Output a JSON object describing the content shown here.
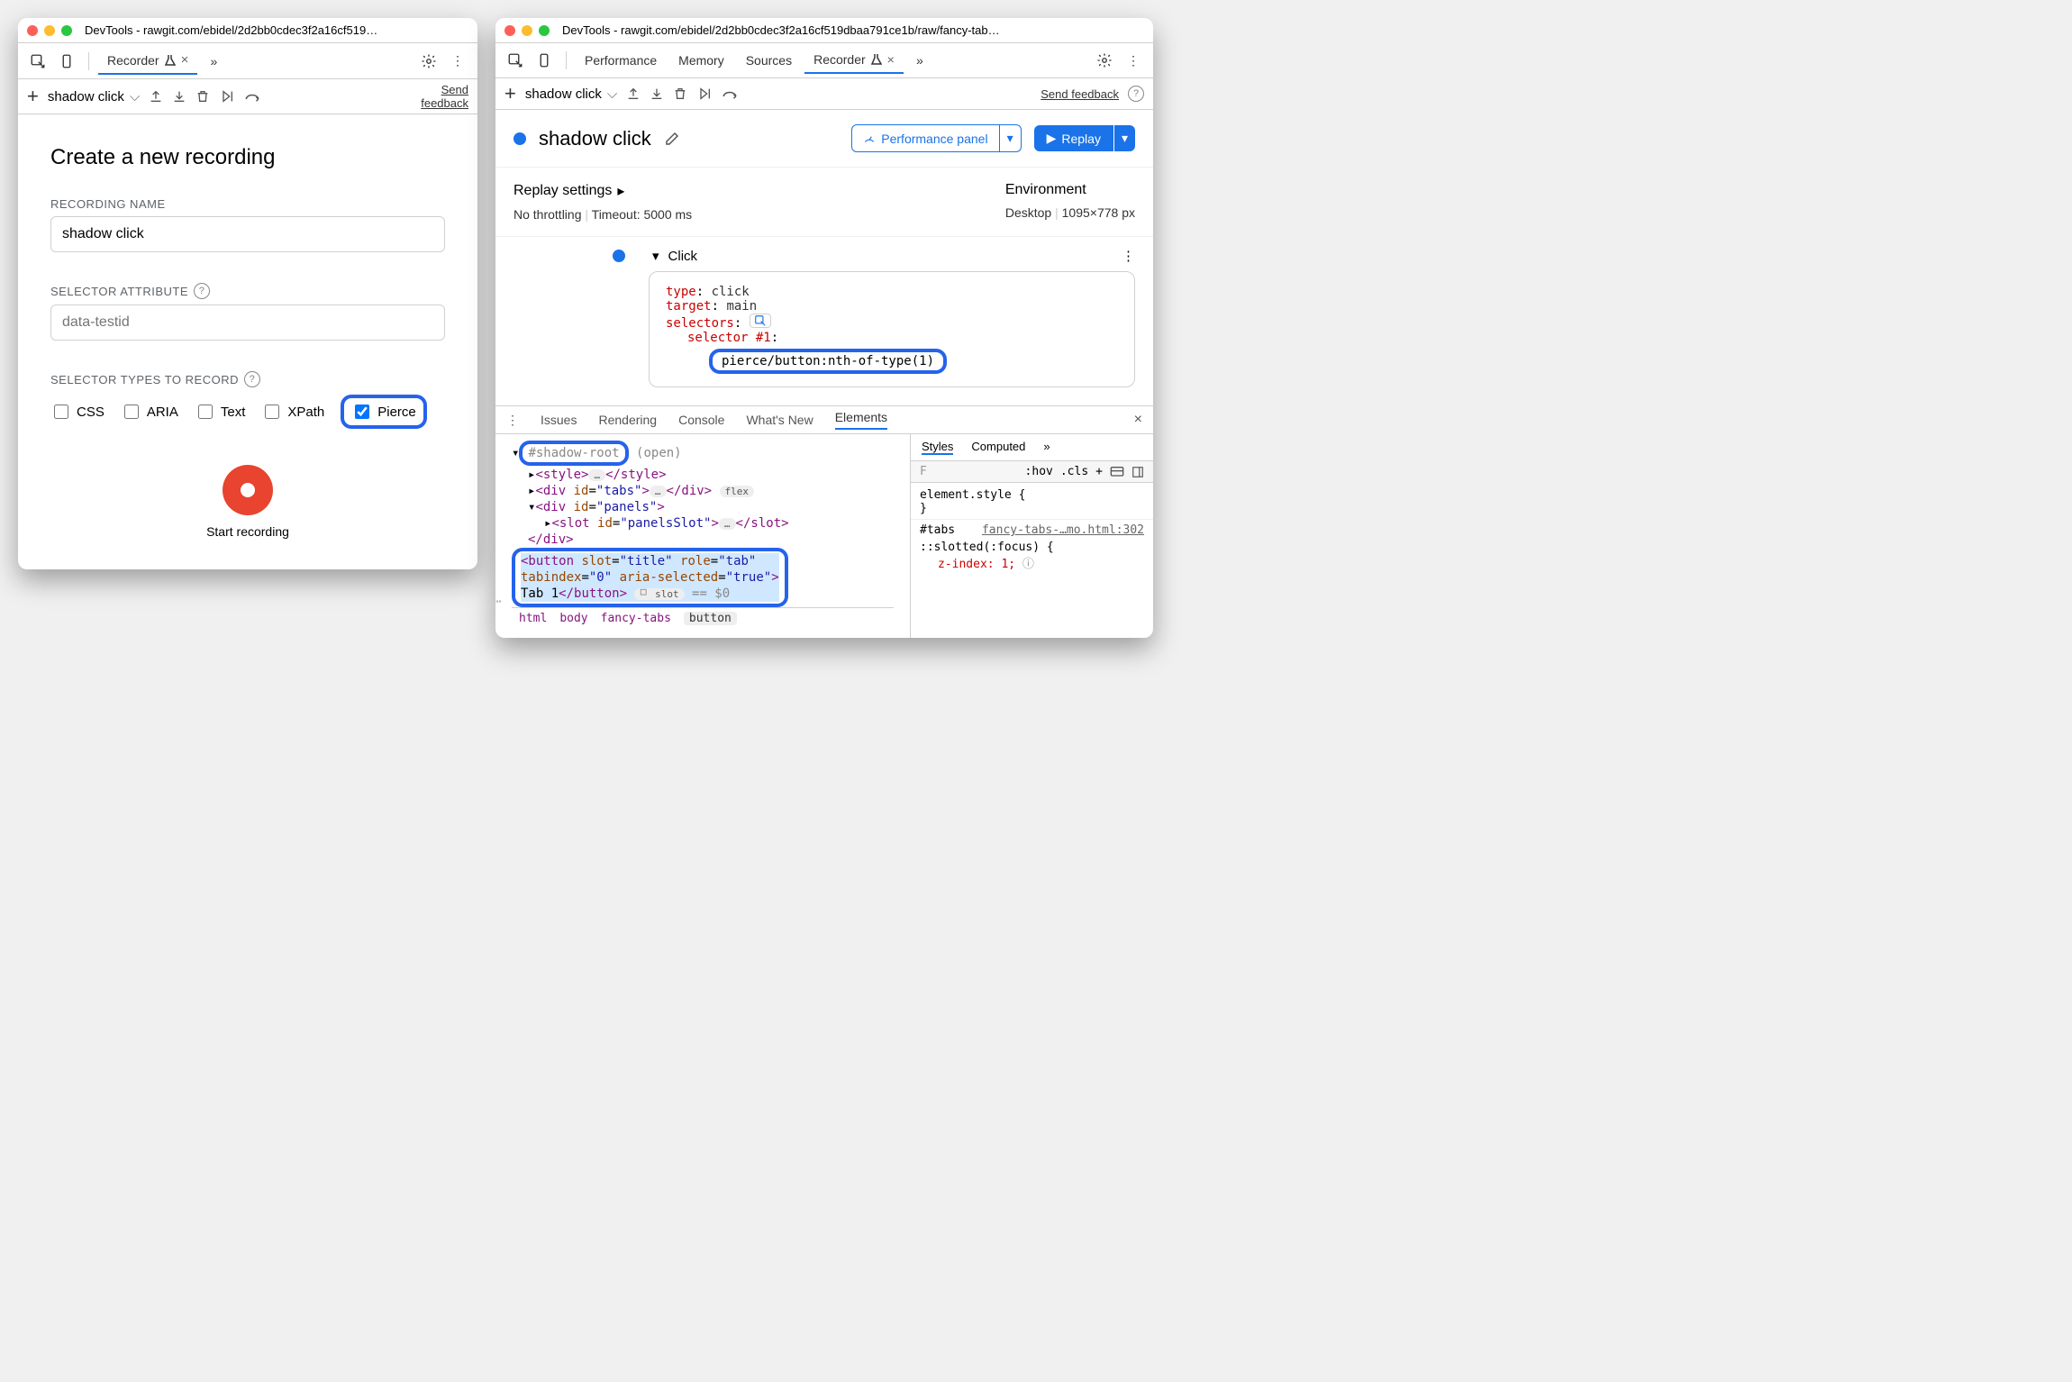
{
  "left": {
    "title": "DevTools - rawgit.com/ebidel/2d2bb0cdec3f2a16cf519…",
    "tab": "Recorder",
    "subbar": {
      "name": "shadow click",
      "feedback": "Send feedback"
    },
    "h2": "Create a new recording",
    "rec_name_label": "RECORDING NAME",
    "rec_name_value": "shadow click",
    "sel_attr_label": "SELECTOR ATTRIBUTE",
    "sel_attr_placeholder": "data-testid",
    "types_label": "SELECTOR TYPES TO RECORD",
    "types": [
      "CSS",
      "ARIA",
      "Text",
      "XPath",
      "Pierce"
    ],
    "start": "Start recording"
  },
  "right": {
    "title": "DevTools - rawgit.com/ebidel/2d2bb0cdec3f2a16cf519dbaa791ce1b/raw/fancy-tab…",
    "tabs": [
      "Performance",
      "Memory",
      "Sources",
      "Recorder"
    ],
    "subbar": {
      "name": "shadow click",
      "feedback": "Send feedback"
    },
    "recname": "shadow click",
    "perf_btn": "Performance panel",
    "replay_btn": "Replay",
    "replay_settings": "Replay settings",
    "throttle": "No throttling",
    "timeout": "Timeout: 5000 ms",
    "env_label": "Environment",
    "env_device": "Desktop",
    "env_size": "1095×778 px",
    "step_name": "Click",
    "card": {
      "type_k": "type",
      "type_v": "click",
      "target_k": "target",
      "target_v": "main",
      "selectors_k": "selectors",
      "sel1_k": "selector #1",
      "sel1_v": "pierce/button:nth-of-type(1)"
    },
    "drawer_tabs": [
      "Issues",
      "Rendering",
      "Console",
      "What's New",
      "Elements"
    ],
    "dom": {
      "shadow": "#shadow-root",
      "open": "(open)",
      "style": "<style>…</style>",
      "tabs_open": "<div id=\"tabs\">",
      "tabs_close": "</div>",
      "flex": "flex",
      "panels_open": "<div id=\"panels\">",
      "slot": "<slot id=\"panelsSlot\">…</slot>",
      "div_close": "</div>",
      "btn1": "<button slot=\"title\" role=\"tab\"",
      "btn2": "tabindex=\"0\" aria-selected=\"true\">",
      "btn3": "Tab 1</button>",
      "slot_badge": "slot",
      "eq": "== $0"
    },
    "crumbs": [
      "html",
      "body",
      "fancy-tabs",
      "button"
    ],
    "styles_tabs": [
      "Styles",
      "Computed"
    ],
    "filter_placeholder": "F",
    "hov": ":hov",
    "cls": ".cls",
    "rule0": "element.style {",
    "sel": "#tabs",
    "src": "fancy-tabs-…mo.html:302",
    "rule1": "::slotted(:focus) {",
    "rule2": "z-index: 1;"
  }
}
